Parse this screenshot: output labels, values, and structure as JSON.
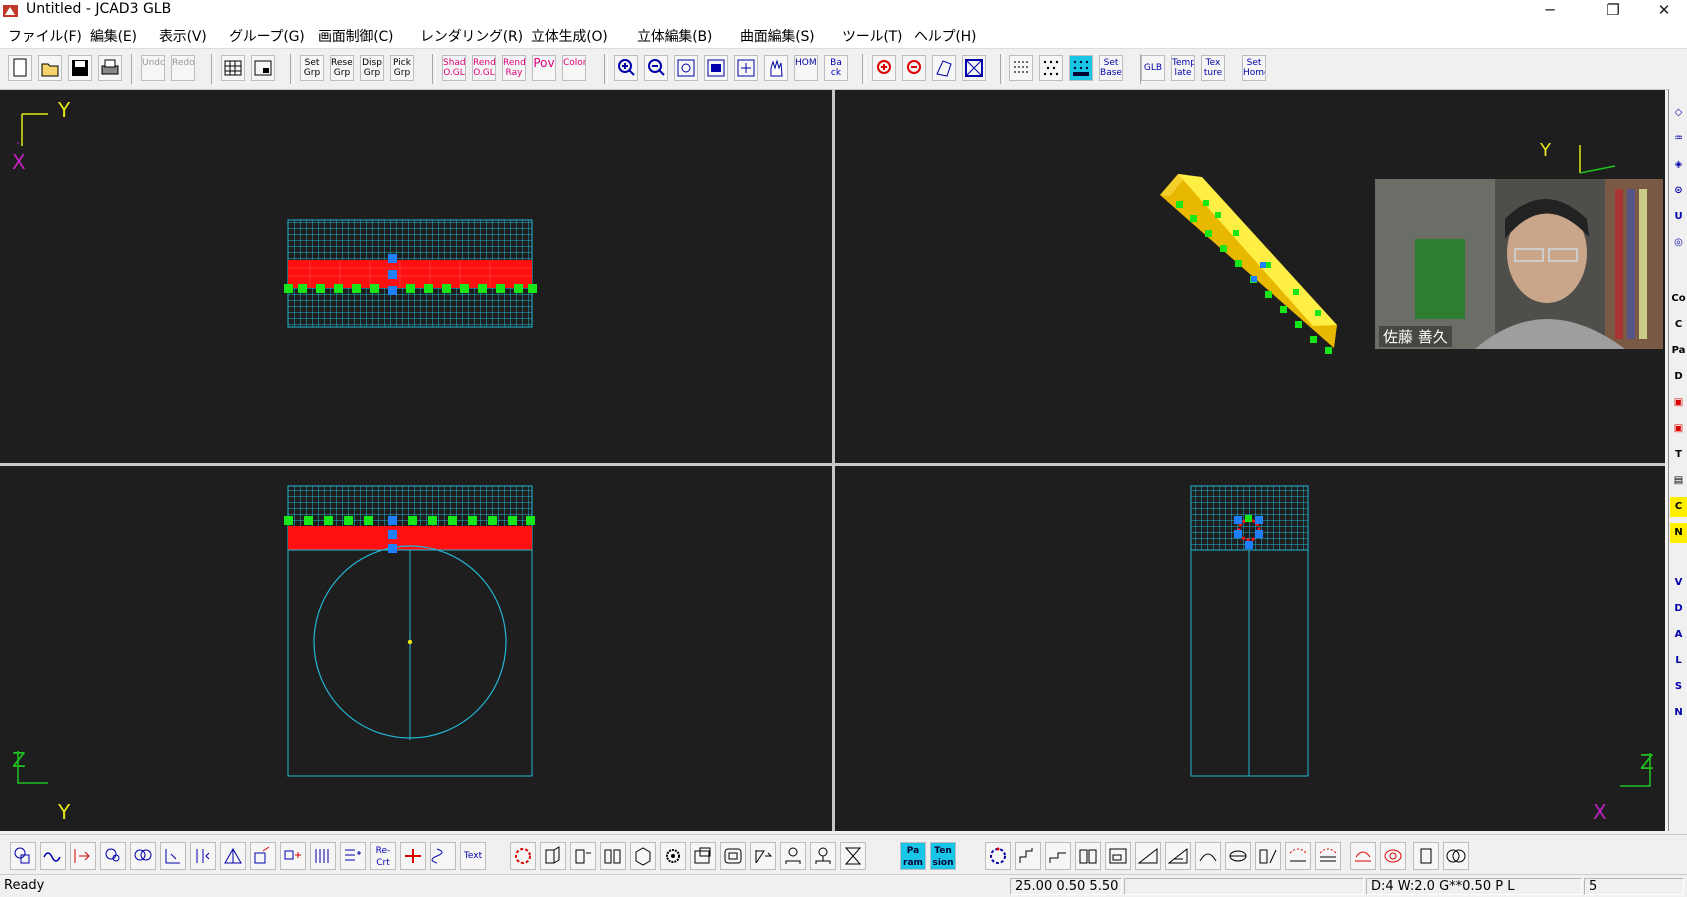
{
  "window": {
    "title": "Untitled - JCAD3 GLB",
    "minimize": "─",
    "restore": "❐",
    "close": "✕"
  },
  "menu": [
    "ファイル(F)",
    "編集(E)",
    "表示(V)",
    "グループ(G)",
    "画面制御(C)",
    "レンダリング(R)",
    "立体生成(O)",
    "立体編集(B)",
    "曲面編集(S)",
    "ツール(T)",
    "ヘルプ(H)"
  ],
  "toolbar": {
    "undo": "Undo",
    "redo": "Redo",
    "set_grp": "Set Grp",
    "reset_grp": "Reset Grp",
    "disp_grp": "Disp Grp",
    "pick_grp": "Pick Grp",
    "shad_ogl": "Shad O.GL",
    "rend_ogl": "Rend O.GL",
    "rend_ray": "Rend Ray",
    "pov": "Pov",
    "color": "Color",
    "home": "HOME",
    "back": "Ba ck",
    "set_base": "Set Base",
    "glb": "GLB",
    "template": "Temp late",
    "texture": "Tex ture",
    "set_home": "Set Home"
  },
  "viewports": {
    "top_left_axis_h": "Y",
    "top_left_axis_v": "X",
    "top_right_axis": "Y",
    "bottom_left_axis_v": "Z",
    "bottom_left_axis_h": "Y",
    "bottom_right_axis_v": "Z",
    "bottom_right_axis_h": "X"
  },
  "webcam": {
    "participant_name": "佐藤 善久"
  },
  "right_strip": [
    "Co",
    "C",
    "Pa",
    "D",
    "C",
    "N",
    "V",
    "D",
    "A",
    "L",
    "S",
    "N"
  ],
  "bottom_toolbar": {
    "recrt": "Re- Crt",
    "text": "Text",
    "param": "Pa ram",
    "tension": "Ten sion"
  },
  "status": {
    "ready": "Ready",
    "coords": "25.00 0.50 5.50",
    "display": "D:4 W:2.0  G**0.50 P   L",
    "count": "5"
  },
  "colors": {
    "viewport_bg": "#1e1e1e",
    "mesh": "#22b8d6",
    "body_red": "#ff1010",
    "marker_green": "#19e619",
    "marker_blue": "#1e7fff",
    "solid_yellow": "#ffee44",
    "axis_yellow": "#e6e619",
    "axis_purple": "#c020c0",
    "axis_green": "#20c020"
  }
}
